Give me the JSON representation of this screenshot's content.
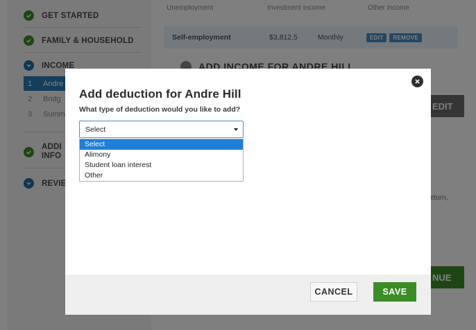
{
  "sidebar": {
    "steps": [
      {
        "label": "GET STARTED",
        "status": "done"
      },
      {
        "label": "FAMILY & HOUSEHOLD",
        "status": "done"
      },
      {
        "label": "INCOME",
        "status": "current"
      },
      {
        "label": "ADDITIONAL INFORMATION",
        "label_line1": "ADDI",
        "label_line2": "INFO",
        "status": "done"
      },
      {
        "label": "REVIE",
        "status": "current"
      }
    ],
    "substeps": [
      {
        "num": "1",
        "label": "Andre"
      },
      {
        "num": "2",
        "label": "Bridg"
      },
      {
        "num": "3",
        "label": "Summ"
      }
    ]
  },
  "main": {
    "columns": [
      "Unemployment",
      "Investment income",
      "Other income"
    ],
    "income_row": {
      "type": "Self-employment",
      "amount": "$3,812.5",
      "frequency": "Monthly",
      "edit_label": "EDIT",
      "remove_label": "REMOVE"
    },
    "add_income_label": "ADD INCOME FOR ANDRE HILL",
    "edit_button": "EDIT",
    "continue_button": "NUE",
    "side_text": "eturn,"
  },
  "modal": {
    "title": "Add deduction for Andre Hill",
    "question": "What type of deduction would you like to add?",
    "select_value": "Select",
    "options": [
      "Select",
      "Alimony",
      "Student loan interest",
      "Other"
    ],
    "cancel_label": "CANCEL",
    "save_label": "SAVE"
  },
  "colors": {
    "overlay": "#000000",
    "accent_green": "#3c8d28",
    "select_highlight": "#1e7fd6",
    "step_blue": "#1f6fa8"
  }
}
